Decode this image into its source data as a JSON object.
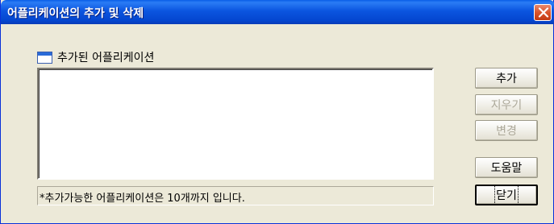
{
  "window": {
    "title": "어플리케이션의 추가 및 삭제",
    "close_icon": "close-icon"
  },
  "list": {
    "label": "추가된 어플리케이션",
    "icon": "list-view-icon",
    "items": []
  },
  "status": {
    "text": "*추가가능한 어플리케이션은 10개까지 입니다."
  },
  "buttons": {
    "add": "추가",
    "remove": "지우기",
    "change": "변경",
    "help": "도움말",
    "close": "닫기"
  }
}
